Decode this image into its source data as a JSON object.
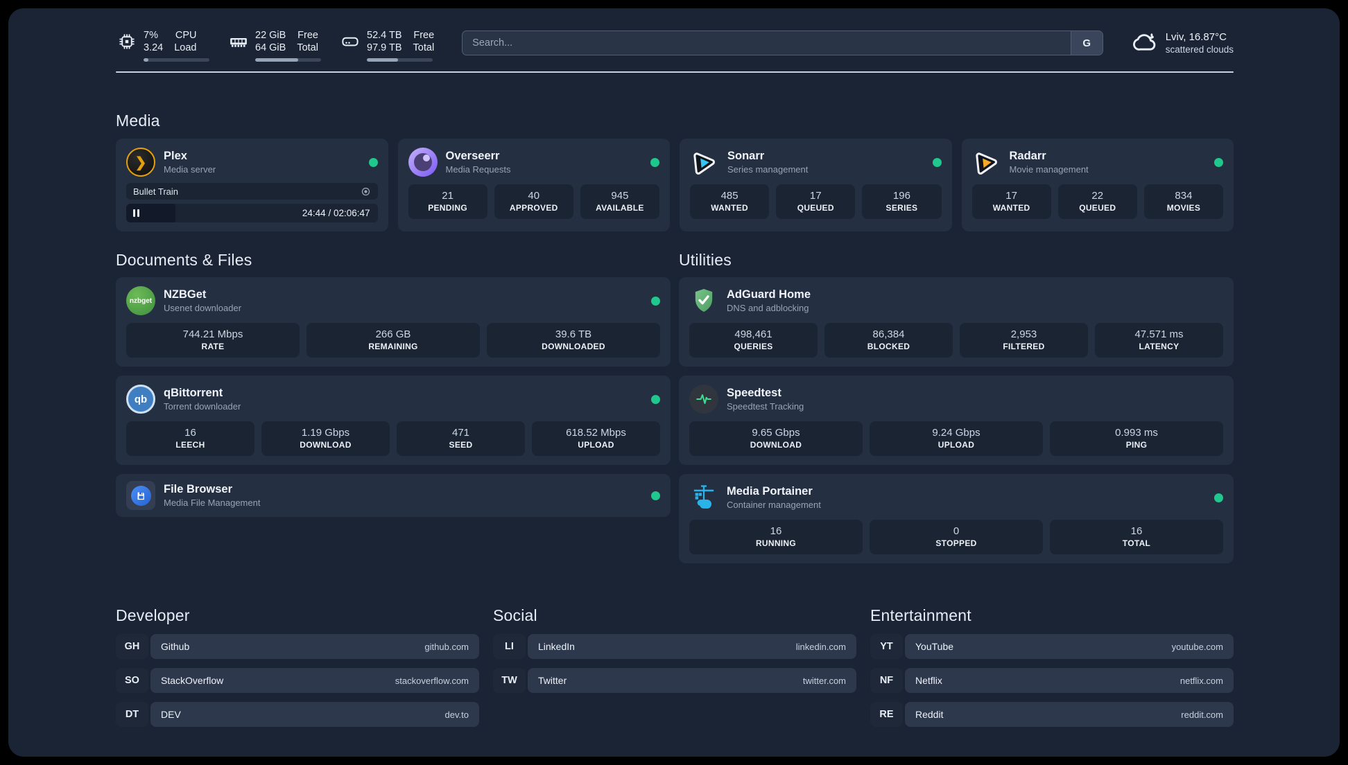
{
  "header": {
    "stats": [
      {
        "icon": "cpu",
        "values": [
          "7%",
          "3.24"
        ],
        "labels": [
          "CPU",
          "Load"
        ],
        "progress": 7
      },
      {
        "icon": "memory",
        "values": [
          "22 GiB",
          "64 GiB"
        ],
        "labels": [
          "Free",
          "Total"
        ],
        "progress": 65
      },
      {
        "icon": "disk",
        "values": [
          "52.4 TB",
          "97.9 TB"
        ],
        "labels": [
          "Free",
          "Total"
        ],
        "progress": 47
      }
    ],
    "search": {
      "placeholder": "Search...",
      "engine_label": "G"
    },
    "weather": {
      "location": "Lviv, 16.87°C",
      "condition": "scattered clouds"
    }
  },
  "sections": {
    "media": {
      "title": "Media",
      "plex": {
        "name": "Plex",
        "desc": "Media server",
        "session": {
          "title": "Bullet Train",
          "time": "24:44 / 02:06:47",
          "progress": 19.5
        }
      },
      "overseerr": {
        "name": "Overseerr",
        "desc": "Media Requests",
        "stats": [
          {
            "value": "21",
            "label": "PENDING"
          },
          {
            "value": "40",
            "label": "APPROVED"
          },
          {
            "value": "945",
            "label": "AVAILABLE"
          }
        ]
      },
      "sonarr": {
        "name": "Sonarr",
        "desc": "Series management",
        "stats": [
          {
            "value": "485",
            "label": "WANTED"
          },
          {
            "value": "17",
            "label": "QUEUED"
          },
          {
            "value": "196",
            "label": "SERIES"
          }
        ]
      },
      "radarr": {
        "name": "Radarr",
        "desc": "Movie management",
        "stats": [
          {
            "value": "17",
            "label": "WANTED"
          },
          {
            "value": "22",
            "label": "QUEUED"
          },
          {
            "value": "834",
            "label": "MOVIES"
          }
        ]
      }
    },
    "documents": {
      "title": "Documents & Files",
      "nzbget": {
        "name": "NZBGet",
        "desc": "Usenet downloader",
        "stats": [
          {
            "value": "744.21 Mbps",
            "label": "RATE"
          },
          {
            "value": "266 GB",
            "label": "REMAINING"
          },
          {
            "value": "39.6 TB",
            "label": "DOWNLOADED"
          }
        ]
      },
      "qbittorrent": {
        "name": "qBittorrent",
        "desc": "Torrent downloader",
        "stats": [
          {
            "value": "16",
            "label": "LEECH"
          },
          {
            "value": "1.19 Gbps",
            "label": "DOWNLOAD"
          },
          {
            "value": "471",
            "label": "SEED"
          },
          {
            "value": "618.52 Mbps",
            "label": "UPLOAD"
          }
        ]
      },
      "filebrowser": {
        "name": "File Browser",
        "desc": "Media File Management"
      }
    },
    "utilities": {
      "title": "Utilities",
      "adguard": {
        "name": "AdGuard Home",
        "desc": "DNS and adblocking",
        "stats": [
          {
            "value": "498,461",
            "label": "QUERIES"
          },
          {
            "value": "86,384",
            "label": "BLOCKED"
          },
          {
            "value": "2,953",
            "label": "FILTERED"
          },
          {
            "value": "47.571 ms",
            "label": "LATENCY"
          }
        ]
      },
      "speedtest": {
        "name": "Speedtest",
        "desc": "Speedtest Tracking",
        "stats": [
          {
            "value": "9.65 Gbps",
            "label": "DOWNLOAD"
          },
          {
            "value": "9.24 Gbps",
            "label": "UPLOAD"
          },
          {
            "value": "0.993 ms",
            "label": "PING"
          }
        ]
      },
      "portainer": {
        "name": "Media Portainer",
        "desc": "Container management",
        "stats": [
          {
            "value": "16",
            "label": "RUNNING"
          },
          {
            "value": "0",
            "label": "STOPPED"
          },
          {
            "value": "16",
            "label": "TOTAL"
          }
        ]
      }
    },
    "links": [
      {
        "title": "Developer",
        "items": [
          {
            "abbr": "GH",
            "name": "Github",
            "url": "github.com"
          },
          {
            "abbr": "SO",
            "name": "StackOverflow",
            "url": "stackoverflow.com"
          },
          {
            "abbr": "DT",
            "name": "DEV",
            "url": "dev.to"
          }
        ]
      },
      {
        "title": "Social",
        "items": [
          {
            "abbr": "LI",
            "name": "LinkedIn",
            "url": "linkedin.com"
          },
          {
            "abbr": "TW",
            "name": "Twitter",
            "url": "twitter.com"
          }
        ]
      },
      {
        "title": "Entertainment",
        "items": [
          {
            "abbr": "YT",
            "name": "YouTube",
            "url": "youtube.com"
          },
          {
            "abbr": "NF",
            "name": "Netflix",
            "url": "netflix.com"
          },
          {
            "abbr": "RE",
            "name": "Reddit",
            "url": "reddit.com"
          }
        ]
      }
    ]
  },
  "colors": {
    "status_green": "#1fc88c",
    "plex_amber": "#e5a00d",
    "sonarr_cyan": "#35c5f4",
    "radarr_amber": "#f7a928",
    "portainer_blue": "#29b3e8"
  }
}
